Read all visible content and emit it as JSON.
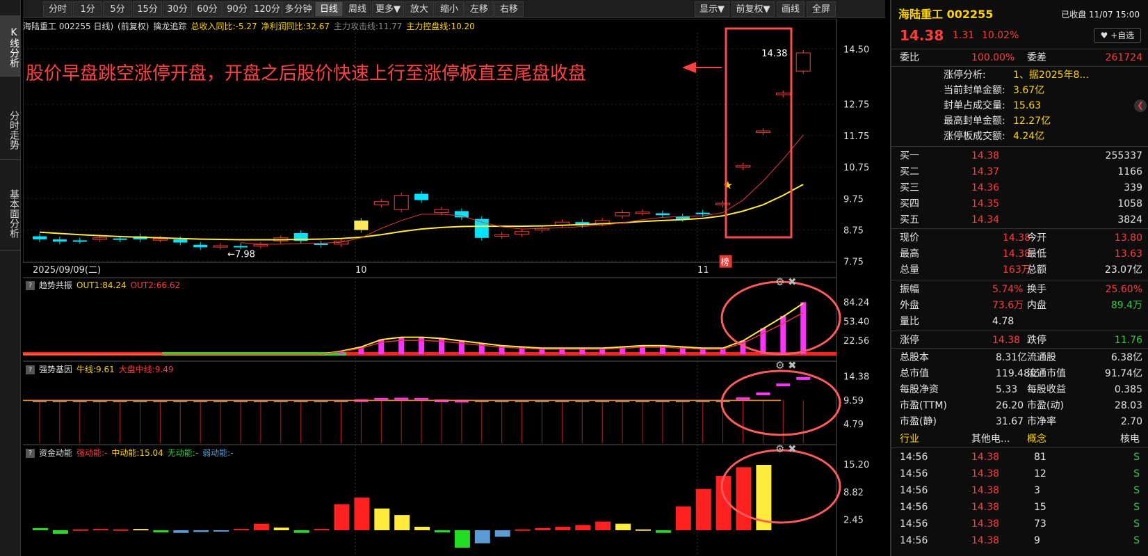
{
  "left_tabs": [
    {
      "label": "K线分析"
    },
    {
      "label": "分时走势"
    },
    {
      "label": "基本面分析"
    }
  ],
  "toolbar": {
    "items": [
      "分时",
      "1分",
      "5分",
      "15分",
      "30分",
      "60分",
      "90分",
      "120分",
      "多分钟",
      "日线",
      "周线",
      "更多▼",
      "放大",
      "缩小",
      "左移",
      "右移"
    ],
    "right_items": [
      "显示▼",
      "前复权▼",
      "画线",
      "全屏"
    ],
    "active": "日线"
  },
  "chart_header": {
    "stock": "海陆重工 002255 日线)",
    "mode": "(前复权)",
    "indicator": "擒龙追踪",
    "t1": "总收入同比:-5.27",
    "t2": "净利润同比:32.67",
    "t3": "主力攻击线:11.77",
    "t4": "主力控盘线:10.20"
  },
  "annotation": {
    "text": "股价早盘跳空涨停开盘，开盘之后股价快速上行至涨停板直至尾盘收盘",
    "price_label": "14.38",
    "low_label": "7.98",
    "bang": "榜"
  },
  "price_axis": [
    "14.50",
    "12.75",
    "11.75",
    "10.75",
    "9.75",
    "8.75",
    "7.75"
  ],
  "date_axis": [
    "2025/09/09(二)",
    "10",
    "11"
  ],
  "panel2": {
    "name": "趋势共振",
    "out1": "OUT1:84.24",
    "out2": "OUT2:66.62",
    "axis": [
      "84.24",
      "53.40",
      "22.56"
    ]
  },
  "panel3": {
    "name": "强势基因",
    "l1": "牛线:9.61",
    "l2": "大盘中线:9.49",
    "axis": [
      "14.38",
      "9.59",
      "4.79"
    ]
  },
  "panel4": {
    "name": "资金动能",
    "l1": "强动能:-",
    "l2": "中动能:15.04",
    "l3": "无动能:-",
    "l4": "弱动能:-",
    "axis": [
      "15.20",
      "8.82",
      "2.45"
    ]
  },
  "chart_data": [
    {
      "type": "candlestick",
      "name": "海陆重工 002255 日线",
      "ylim": [
        7.5,
        14.8
      ],
      "candles": [
        {
          "o": 8.55,
          "c": 8.45
        },
        {
          "o": 8.45,
          "c": 8.38
        },
        {
          "o": 8.42,
          "c": 8.4
        },
        {
          "o": 8.45,
          "c": 8.5
        },
        {
          "o": 8.48,
          "c": 8.45
        },
        {
          "o": 8.55,
          "c": 8.45
        },
        {
          "o": 8.45,
          "c": 8.47
        },
        {
          "o": 8.45,
          "c": 8.35
        },
        {
          "o": 8.28,
          "c": 8.2
        },
        {
          "o": 8.22,
          "c": 8.25
        },
        {
          "o": 8.24,
          "c": 8.22
        },
        {
          "o": 8.25,
          "c": 8.28
        },
        {
          "o": 8.4,
          "c": 8.5
        },
        {
          "o": 8.65,
          "c": 8.4
        },
        {
          "o": 8.32,
          "c": 8.28
        },
        {
          "o": 8.3,
          "c": 8.4
        },
        {
          "o": 9.05,
          "c": 8.75
        },
        {
          "o": 9.55,
          "c": 9.65
        },
        {
          "o": 9.4,
          "c": 9.85
        },
        {
          "o": 9.9,
          "c": 9.7
        },
        {
          "o": 9.3,
          "c": 9.4
        },
        {
          "o": 9.35,
          "c": 9.15
        },
        {
          "o": 9.1,
          "c": 8.5
        },
        {
          "o": 8.55,
          "c": 8.6
        },
        {
          "o": 8.62,
          "c": 8.7
        },
        {
          "o": 8.75,
          "c": 8.8
        },
        {
          "o": 8.9,
          "c": 9.0
        },
        {
          "o": 9.0,
          "c": 8.9
        },
        {
          "o": 8.95,
          "c": 9.05
        },
        {
          "o": 9.2,
          "c": 9.3
        },
        {
          "o": 9.3,
          "c": 9.32
        },
        {
          "o": 9.28,
          "c": 9.22
        },
        {
          "o": 9.18,
          "c": 9.1
        },
        {
          "o": 9.3,
          "c": 9.25
        },
        {
          "o": 9.55,
          "c": 9.6
        },
        {
          "o": 10.75,
          "c": 10.8
        },
        {
          "o": 11.85,
          "c": 11.9
        },
        {
          "o": 13.05,
          "c": 13.1
        },
        {
          "o": 13.8,
          "c": 14.38
        }
      ],
      "ma_yellow": [
        8.68,
        8.64,
        8.6,
        8.57,
        8.54,
        8.52,
        8.5,
        8.48,
        8.46,
        8.45,
        8.44,
        8.44,
        8.44,
        8.45,
        8.46,
        8.48,
        8.52,
        8.6,
        8.7,
        8.78,
        8.83,
        8.86,
        8.87,
        8.87,
        8.87,
        8.88,
        8.9,
        8.92,
        8.95,
        8.98,
        9.02,
        9.05,
        9.08,
        9.12,
        9.2,
        9.35,
        9.55,
        9.85,
        10.2
      ],
      "ma_red": [
        null,
        null,
        null,
        null,
        null,
        null,
        null,
        null,
        null,
        null,
        8.35,
        8.3,
        8.3,
        8.32,
        8.33,
        8.36,
        8.5,
        8.8,
        9.05,
        9.25,
        9.25,
        9.2,
        9.0,
        8.85,
        8.78,
        8.8,
        8.82,
        8.86,
        8.9,
        8.98,
        9.08,
        9.15,
        9.18,
        9.2,
        9.3,
        9.7,
        10.3,
        11.0,
        11.77
      ]
    },
    {
      "type": "bar",
      "name": "趋势共振",
      "ylim": [
        0,
        90
      ],
      "values": [
        0,
        0,
        0,
        0,
        0,
        0,
        0,
        0,
        0,
        0,
        0,
        0,
        0,
        0,
        0,
        0,
        5,
        12,
        24,
        28,
        28,
        26,
        22,
        18,
        14,
        12,
        10,
        10,
        10,
        10,
        12,
        14,
        14,
        12,
        10,
        10,
        22,
        42,
        62,
        84
      ]
    },
    {
      "type": "bar",
      "name": "强势基因",
      "ylim": [
        2,
        16
      ],
      "values": [
        9.55,
        9.55,
        9.55,
        9.55,
        9.55,
        9.55,
        9.55,
        9.55,
        9.55,
        9.55,
        9.55,
        9.55,
        9.55,
        9.55,
        9.55,
        9.55,
        9.75,
        10.0,
        10.05,
        10.0,
        9.7,
        9.65,
        9.6,
        9.58,
        9.58,
        9.58,
        9.58,
        9.58,
        9.58,
        9.58,
        9.58,
        9.58,
        9.58,
        9.58,
        9.58,
        10.1,
        11.1,
        12.9,
        14.2
      ]
    },
    {
      "type": "bar",
      "name": "资金动能",
      "ylim": [
        -2,
        16
      ],
      "values": [
        0.5,
        -0.8,
        0.2,
        0.3,
        0.2,
        0.3,
        -0.5,
        -0.6,
        -0.4,
        -0.2,
        0.3,
        1.5,
        0.6,
        -0.6,
        0.3,
        6.0,
        7.5,
        5.0,
        3.5,
        0.8,
        -0.5,
        -4.0,
        -3.0,
        -1.5,
        0.2,
        0.5,
        0.8,
        1.2,
        2.0,
        1.5,
        0.2,
        -0.6,
        5.5,
        9.5,
        12.5,
        14.5,
        15.04
      ]
    }
  ],
  "right_panel": {
    "title": "海陆重工 002255",
    "status": "已收盘 11/07 15:00",
    "price": "14.38",
    "change": "1.31",
    "pct": "10.02%",
    "watch": "+自选",
    "wb_label": "委比",
    "wb": "100.00%",
    "wc_label": "委差",
    "wc": "261724",
    "zt_lines": [
      [
        "涨停分析:",
        "1、据2025年8..."
      ],
      [
        "当前封单金额:",
        "3.67亿"
      ],
      [
        "封单占成交量:",
        "15.63"
      ],
      [
        "最高封单金额:",
        "12.27亿"
      ],
      [
        "涨停板成交额:",
        "4.24亿"
      ]
    ],
    "bids": [
      [
        "买一",
        "14.38",
        "255337"
      ],
      [
        "买二",
        "14.37",
        "1166"
      ],
      [
        "买三",
        "14.36",
        "339"
      ],
      [
        "买四",
        "14.35",
        "1058"
      ],
      [
        "买五",
        "14.34",
        "3824"
      ]
    ],
    "quote": [
      [
        "现价",
        "14.38",
        "今开",
        "13.80"
      ],
      [
        "最高",
        "14.38",
        "最低",
        "13.63"
      ],
      [
        "总量",
        "163万",
        "总额",
        "23.07亿"
      ]
    ],
    "quote2": [
      [
        "振幅",
        "5.74%",
        "换手",
        "25.60%"
      ],
      [
        "外盘",
        "73.6万",
        "内盘",
        "89.4万"
      ],
      [
        "量比",
        "4.78",
        "",
        ""
      ]
    ],
    "limit": [
      "涨停",
      "14.38",
      "跌停",
      "11.76"
    ],
    "fund": [
      [
        "总股本",
        "8.31亿",
        "流通股",
        "6.38亿"
      ],
      [
        "总市值",
        "119.48亿",
        "流通市值",
        "91.74亿"
      ],
      [
        "每股净资",
        "5.33",
        "每股收益",
        "0.385"
      ],
      [
        "市盈(TTM)",
        "26.20",
        "市盈(动)",
        "28.03"
      ],
      [
        "市盈(静)",
        "31.67",
        "市净率",
        "2.70"
      ]
    ],
    "tabs": [
      "行业",
      "其他电...",
      "概念",
      "核电"
    ],
    "ticks": [
      [
        "14:56",
        "14.38",
        "81",
        "S"
      ],
      [
        "14:56",
        "14.38",
        "12",
        "S"
      ],
      [
        "14:56",
        "14.38",
        "3",
        "S"
      ],
      [
        "14:56",
        "14.38",
        "15",
        "S"
      ],
      [
        "14:56",
        "14.38",
        "73",
        "S"
      ],
      [
        "14:56",
        "14.38",
        "9",
        "S"
      ]
    ]
  }
}
